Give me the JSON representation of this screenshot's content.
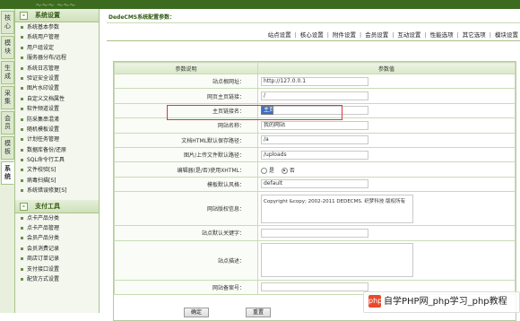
{
  "topbar": {
    "hint": "〜〜〜 〜〜〜"
  },
  "vtabs": [
    "核心",
    "模块",
    "生成",
    "采集",
    "会员",
    "模板",
    "系统"
  ],
  "sidebar": {
    "section1": {
      "collapse": "-",
      "title": "系统设置",
      "items": [
        "系统基本参数",
        "系统用户管理",
        "用户组设定",
        "服务器分布/远程",
        "系统日志管理",
        "验证安全设置",
        "图片水印设置",
        "自定义文档属性",
        "软件频道设置",
        "防采集串混淆",
        "随机模板设置",
        "计划任务管理",
        "数据库备份/还原",
        "SQL命令行工具",
        "文件校验[S]",
        "病毒扫描[S]",
        "系统错误修复[S]"
      ]
    },
    "section2": {
      "collapse": "-",
      "title": "支付工具",
      "items": [
        "点卡产品分类",
        "点卡产品管理",
        "会员产品分类",
        "会员消费记录",
        "商店订单记录",
        "支付接口设置",
        "配货方式设置"
      ]
    }
  },
  "main": {
    "title": "DedeCMS系统配置参数：",
    "nav": [
      "站点设置",
      "核心设置",
      "附件设置",
      "会员设置",
      "互动设置",
      "性能选项",
      "其它选项",
      "模块设置"
    ],
    "nav_sep": "|",
    "table": {
      "col_label": "参数说明",
      "col_value": "参数值",
      "rows": [
        {
          "label": "站点根网址：",
          "value": "http://127.0.0.1"
        },
        {
          "label": "网页主页链接：",
          "value": "/"
        },
        {
          "label": "主页链接名：",
          "value": "主页"
        },
        {
          "label": "网站名称：",
          "value": "我的网站"
        },
        {
          "label": "文档HTML默认保存路径：",
          "value": "/a"
        },
        {
          "label": "图片/上传文件默认路径：",
          "value": "/uploads"
        },
        {
          "label": "编辑器(是/否)使用XHTML：",
          "yes": "是",
          "no": "否"
        },
        {
          "label": "模板默认风格：",
          "value": "default"
        },
        {
          "label": "网站版权信息：",
          "value": "Copyright &copy; 2002-2011 DEDECMS. 织梦科技 版权所有"
        },
        {
          "label": "站点默认关键字：",
          "value": ""
        },
        {
          "label": "站点描述：",
          "value": ""
        },
        {
          "label": "网站备案号：",
          "value": ""
        }
      ]
    },
    "buttons": {
      "confirm": "确定",
      "reset": "重置"
    }
  },
  "watermark": {
    "logo": "php",
    "text": "自学PHP网_php学习_php教程"
  }
}
